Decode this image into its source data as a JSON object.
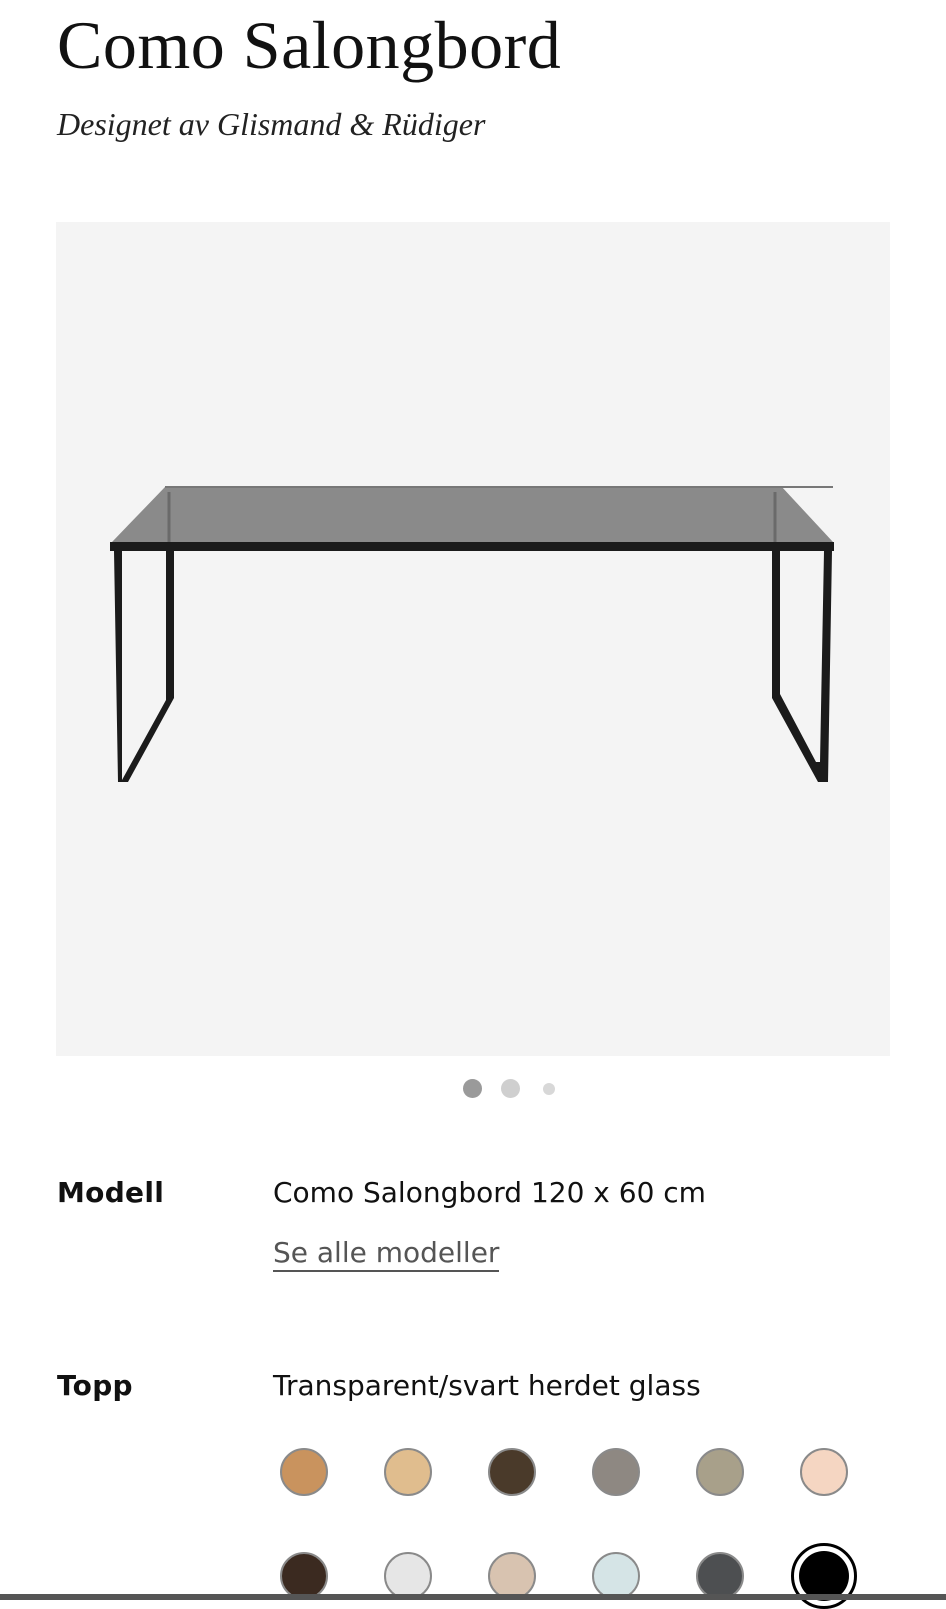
{
  "product": {
    "title": "Como Salongbord",
    "designer": "Designet av Glismand & Rüdiger"
  },
  "gallery": {
    "image_alt": "Como Salongbord",
    "current_index": 1,
    "total": 3
  },
  "options": {
    "modell": {
      "label": "Modell",
      "value": "Como Salongbord 120 x 60 cm",
      "link": "Se alle modeller"
    },
    "topp": {
      "label": "Topp",
      "value": "Transparent/svart herdet glass",
      "swatches_row1": [
        "#c9935e",
        "#e0bd8e",
        "#4a3a2a",
        "#8e8882",
        "#a8a08a",
        "#f5d6c2"
      ],
      "swatches_row2": [
        "#3b2a20",
        "#e6e6e6",
        "#d8c3b0",
        "#d5e4e6",
        "#4d4f51",
        "#000000"
      ],
      "selected_swatch": "row2-6"
    }
  },
  "colors": {
    "image_background": "#f4f4f4",
    "table_glass": "#8a8a8a",
    "table_frame": "#1b1b1b"
  }
}
